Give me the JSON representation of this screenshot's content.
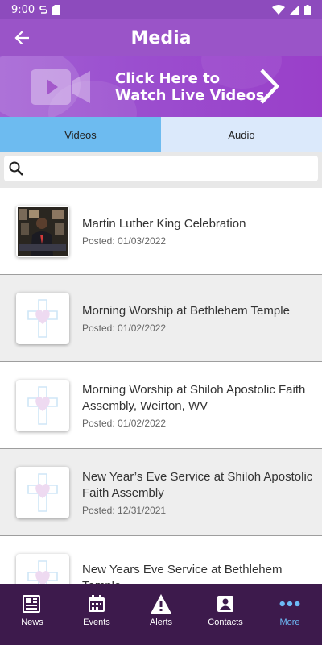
{
  "status_bar": {
    "time": "9:00"
  },
  "header": {
    "title": "Media"
  },
  "banner": {
    "line1": "Click Here to",
    "line2": "Watch Live Videos"
  },
  "tabs": [
    {
      "label": "Videos"
    },
    {
      "label": "Audio"
    }
  ],
  "search": {
    "placeholder": ""
  },
  "items": [
    {
      "title": "Martin Luther King Celebration",
      "date": "Posted: 01/03/2022"
    },
    {
      "title": "Morning Worship at Bethlehem Temple",
      "date": "Posted: 01/02/2022"
    },
    {
      "title": "Morning Worship at Shiloh Apostolic Faith Assembly, Weirton, WV",
      "date": "Posted: 01/02/2022"
    },
    {
      "title": "New Year’s Eve Service at Shiloh Apostolic Faith Assembly",
      "date": "Posted: 12/31/2021"
    },
    {
      "title": "New Years Eve Service at Bethlehem Temple",
      "date": ""
    }
  ],
  "nav": [
    {
      "label": "News"
    },
    {
      "label": "Events"
    },
    {
      "label": "Alerts"
    },
    {
      "label": "Contacts"
    },
    {
      "label": "More"
    }
  ],
  "colors": {
    "status_bar": "#8d4bbd",
    "app_bar": "#9a54c8",
    "active_tab": "#6dbbf0",
    "nav_bg": "#3d1a4c",
    "nav_active": "#6db9f5"
  }
}
